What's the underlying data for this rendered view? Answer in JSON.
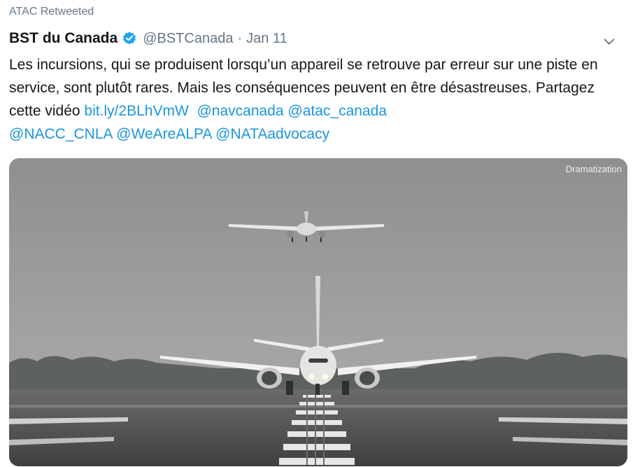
{
  "retweet": {
    "label": "ATAC Retweeted"
  },
  "author": {
    "display_name": "BST du Canada",
    "verified": true,
    "handle": "@BSTCanada",
    "separator": "·",
    "date": "Jan 11"
  },
  "tweet": {
    "text_1": "Les incursions, qui se produisent lorsqu’un appareil se retrouve par erreur sur une piste en service, sont plutôt rares. Mais les conséquences peuvent en être désastreuses. Partagez cette vidéo ",
    "link": "bit.ly/2BLhVmW",
    "mentions": [
      "@navcanada",
      "@atac_canada",
      "@NACC_CNLA",
      "@WeAreALPA",
      "@NATAadvocacy"
    ]
  },
  "media": {
    "watermark": "Dramatization"
  },
  "colors": {
    "link": "#1b95e0",
    "secondary_text": "#657786",
    "verified_badge": "#1da1f2"
  },
  "icons": [
    "verified-badge-icon",
    "chevron-down-icon"
  ]
}
